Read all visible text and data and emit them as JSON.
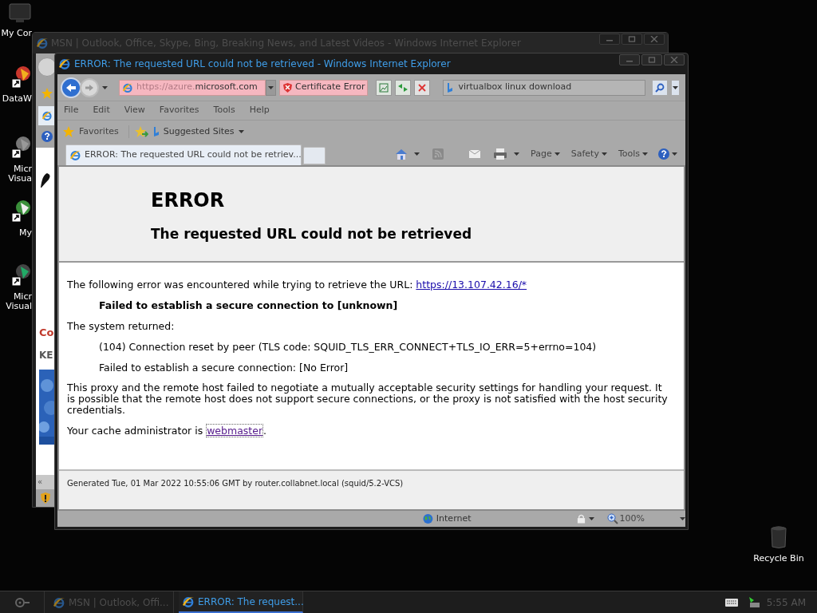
{
  "desktop": {
    "icons": [
      {
        "lines": [
          "My Cor"
        ],
        "kind": "monitor"
      },
      {
        "lines": [
          "DataW"
        ],
        "kind": "shortcut"
      },
      {
        "lines": [
          "Micr",
          "Visua"
        ],
        "kind": "shortcut"
      },
      {
        "lines": [
          "My"
        ],
        "kind": "shortcut"
      },
      {
        "lines": [
          "Micr",
          "Visual"
        ],
        "kind": "shortcut"
      }
    ],
    "recycle_bin": "Recycle Bin"
  },
  "back_window": {
    "title": "MSN | Outlook, Office, Skype, Bing, Breaking News, and Latest Videos - Windows Internet Explorer",
    "heading_fragment": "Co",
    "text_fragment": "KE",
    "scroll_glyph": "«"
  },
  "window": {
    "title": "ERROR: The requested URL could not be retrieved - Windows Internet Explorer",
    "address": {
      "faded_part": "https://azure.",
      "domain": "microsoft.com"
    },
    "certificate_error": "Certificate Error",
    "search": {
      "value": "virtualbox linux download"
    },
    "menu": [
      "File",
      "Edit",
      "View",
      "Favorites",
      "Tools",
      "Help"
    ],
    "favorites_button": "Favorites",
    "suggested_sites": "Suggested Sites",
    "tabs": [
      {
        "label": "ERROR: The requested URL could not be retriev...",
        "selected": true
      }
    ],
    "command_bar": [
      "Page",
      "Safety",
      "Tools"
    ],
    "page": {
      "heading": "ERROR",
      "subheading": "The requested URL could not be retrieved",
      "intro": "The following error was encountered while trying to retrieve the URL: ",
      "url": "https://13.107.42.16/*",
      "failure": "Failed to establish a secure connection to [unknown]",
      "system_returned": "The system returned:",
      "details": [
        "(104) Connection reset by peer (TLS code: SQUID_TLS_ERR_CONNECT+TLS_IO_ERR=5+errno=104)",
        "Failed to establish a secure connection: [No Error]"
      ],
      "explanation": "This proxy and the remote host failed to negotiate a mutually acceptable security settings for handling your request. It is possible that the remote host does not support secure connections, or the proxy is not satisfied with the host security credentials.",
      "admin_prefix": "Your cache administrator is ",
      "admin_link": "webmaster",
      "admin_suffix": ".",
      "footer": "Generated Tue, 01 Mar 2022 10:55:06 GMT by router.collabnet.local (squid/5.2-VCS)"
    },
    "status_bar": {
      "zone": "Internet",
      "zoom": "100%"
    }
  },
  "taskbar": {
    "items": [
      {
        "label": "MSN | Outlook, Offi...",
        "selected": false
      },
      {
        "label": "ERROR: The request...",
        "selected": true
      }
    ],
    "clock": "5:55 AM"
  }
}
